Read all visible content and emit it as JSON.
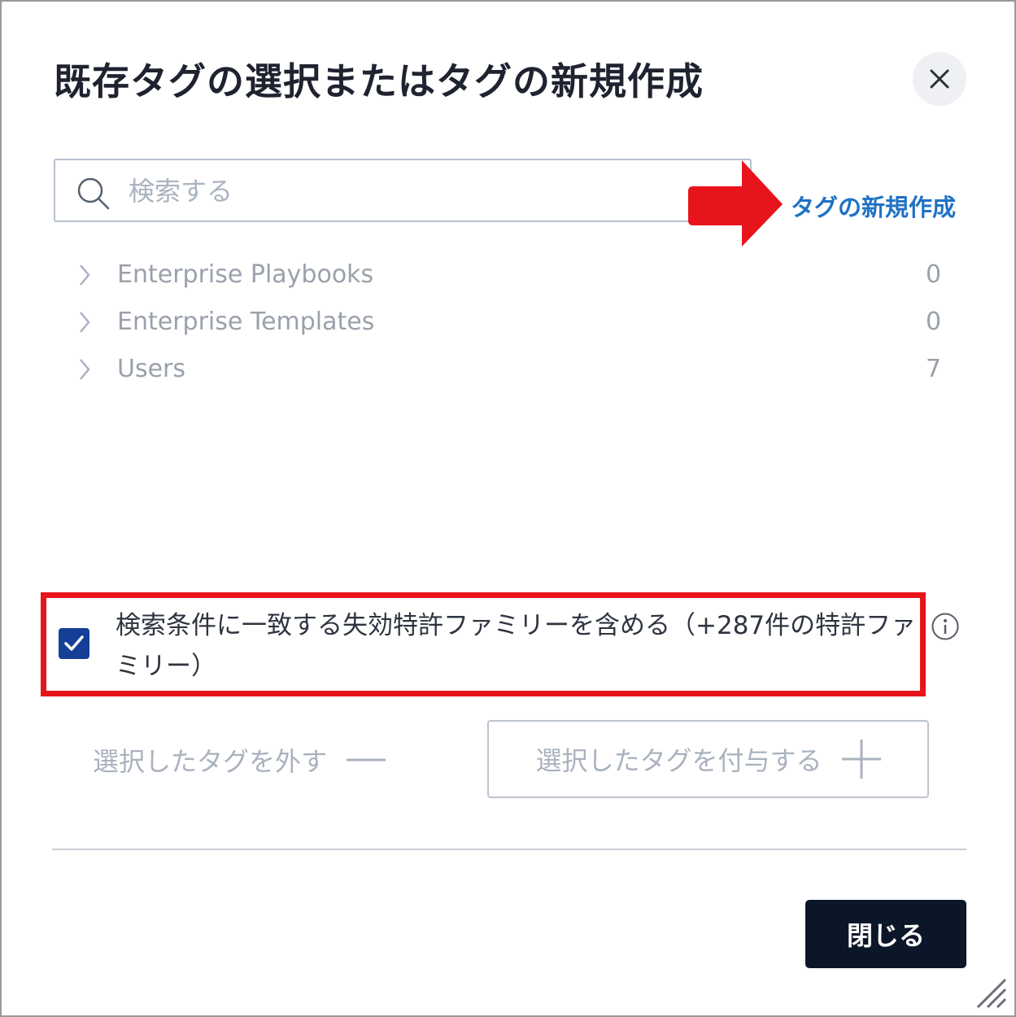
{
  "dialog": {
    "title": "既存タグの選択またはタグの新規作成",
    "close_icon": "close-icon"
  },
  "search": {
    "placeholder": "検索する",
    "value": "",
    "icon": "search-icon"
  },
  "new_tag_link": "タグの新規作成",
  "annotation_color": "#e8141c",
  "tag_tree": [
    {
      "label": "Enterprise Playbooks",
      "count": "0"
    },
    {
      "label": "Enterprise Templates",
      "count": "0"
    },
    {
      "label": "Users",
      "count": "7"
    }
  ],
  "include_expired": {
    "checked": true,
    "label": "検索条件に一致する失効特許ファミリーを含める（+287件の特許ファミリー）",
    "info_icon": "info-icon"
  },
  "actions": {
    "remove_label": "選択したタグを外す",
    "add_label": "選択したタグを付与する"
  },
  "footer": {
    "close_label": "閉じる"
  },
  "colors": {
    "link": "#1f72c5",
    "primary_button": "#0c1629",
    "checkbox": "#153f96"
  }
}
